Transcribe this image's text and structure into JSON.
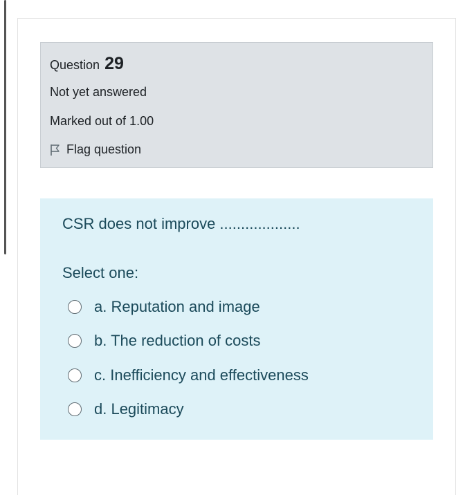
{
  "question": {
    "title_prefix": "Question",
    "number": "29",
    "state": "Not yet answered",
    "grade": "Marked out of 1.00",
    "flag_label": "Flag question"
  },
  "content": {
    "question_text": "CSR does not improve ...................",
    "prompt": "Select one:",
    "answers": [
      {
        "label": "a. Reputation and image"
      },
      {
        "label": "b. The reduction of costs"
      },
      {
        "label": "c. Inefficiency and effectiveness"
      },
      {
        "label": "d. Legitimacy"
      }
    ]
  }
}
